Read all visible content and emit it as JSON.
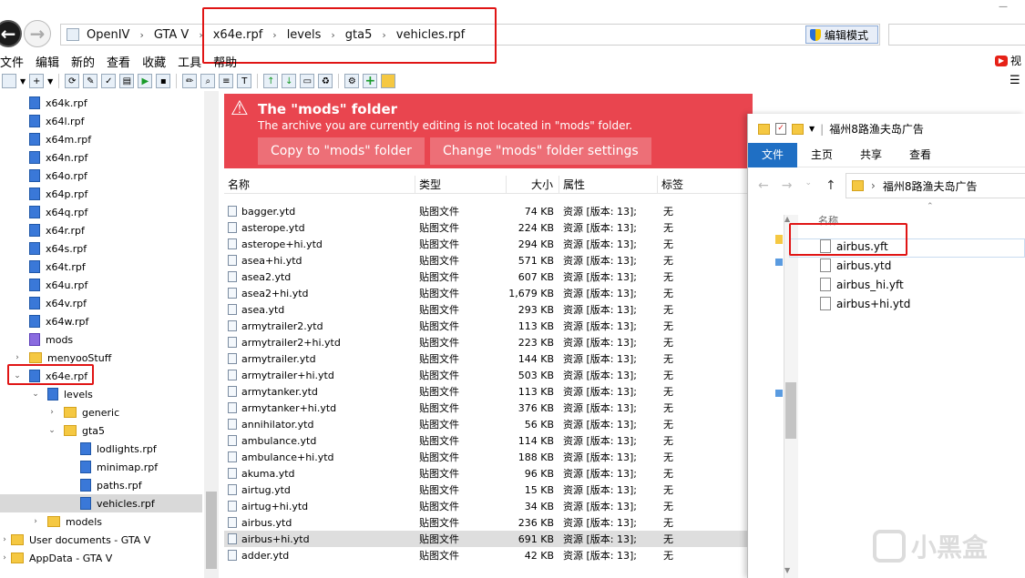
{
  "breadcrumb": {
    "items": [
      "OpenIV",
      "GTA V",
      "x64e.rpf",
      "levels",
      "gta5",
      "vehicles.rpf"
    ],
    "separator": "›"
  },
  "toolbar_top": {
    "edit_mode_label": "编辑模式"
  },
  "menu": [
    "文件",
    "编辑",
    "新的",
    "查看",
    "收藏",
    "工具",
    "帮助"
  ],
  "right_menu_partial": "视",
  "tree": {
    "items": [
      {
        "label": "x64k.rpf",
        "type": "rpf",
        "level": 1
      },
      {
        "label": "x64l.rpf",
        "type": "rpf",
        "level": 1
      },
      {
        "label": "x64m.rpf",
        "type": "rpf",
        "level": 1
      },
      {
        "label": "x64n.rpf",
        "type": "rpf",
        "level": 1
      },
      {
        "label": "x64o.rpf",
        "type": "rpf",
        "level": 1
      },
      {
        "label": "x64p.rpf",
        "type": "rpf",
        "level": 1
      },
      {
        "label": "x64q.rpf",
        "type": "rpf",
        "level": 1
      },
      {
        "label": "x64r.rpf",
        "type": "rpf",
        "level": 1
      },
      {
        "label": "x64s.rpf",
        "type": "rpf",
        "level": 1
      },
      {
        "label": "x64t.rpf",
        "type": "rpf",
        "level": 1
      },
      {
        "label": "x64u.rpf",
        "type": "rpf",
        "level": 1
      },
      {
        "label": "x64v.rpf",
        "type": "rpf",
        "level": 1
      },
      {
        "label": "x64w.rpf",
        "type": "rpf",
        "level": 1
      },
      {
        "label": "mods",
        "type": "mods",
        "level": 1
      },
      {
        "label": "menyooStuff",
        "type": "folder",
        "level": 1,
        "arrow": "›"
      },
      {
        "label": "x64e.rpf",
        "type": "rpf",
        "level": 1,
        "arrow": "⌄"
      },
      {
        "label": "levels",
        "type": "rpf",
        "level": 2,
        "arrow": "⌄"
      },
      {
        "label": "generic",
        "type": "folder",
        "level": 3,
        "arrow": "›"
      },
      {
        "label": "gta5",
        "type": "folder",
        "level": 3,
        "arrow": "⌄"
      },
      {
        "label": "lodlights.rpf",
        "type": "rpf",
        "level": 4
      },
      {
        "label": "minimap.rpf",
        "type": "rpf",
        "level": 4
      },
      {
        "label": "paths.rpf",
        "type": "rpf",
        "level": 4
      },
      {
        "label": "vehicles.rpf",
        "type": "rpf",
        "level": 4,
        "selected": true
      },
      {
        "label": "models",
        "type": "folder",
        "level": 2,
        "arrow": "›"
      },
      {
        "label": "User documents - GTA V",
        "type": "folder",
        "level": 0,
        "arrow": "›"
      },
      {
        "label": "AppData - GTA V",
        "type": "folder",
        "level": 0,
        "arrow": "›"
      }
    ]
  },
  "banner": {
    "icon": "warning-icon",
    "title": "The \"mods\" folder",
    "description": "The archive you are currently editing is not located in \"mods\" folder.",
    "copy_button": "Copy to \"mods\" folder",
    "change_button": "Change \"mods\" folder settings",
    "color": "#e9454f"
  },
  "columns": {
    "name": "名称",
    "type": "类型",
    "size": "大小",
    "attr": "属性",
    "tag": "标签"
  },
  "files": [
    {
      "name": "bagger.ytd",
      "type": "贴图文件",
      "size": "74 KB",
      "attr": "资源 [版本: 13];",
      "tag": "无"
    },
    {
      "name": "asterope.ytd",
      "type": "贴图文件",
      "size": "224 KB",
      "attr": "资源 [版本: 13];",
      "tag": "无"
    },
    {
      "name": "asterope+hi.ytd",
      "type": "贴图文件",
      "size": "294 KB",
      "attr": "资源 [版本: 13];",
      "tag": "无"
    },
    {
      "name": "asea+hi.ytd",
      "type": "贴图文件",
      "size": "571 KB",
      "attr": "资源 [版本: 13];",
      "tag": "无"
    },
    {
      "name": "asea2.ytd",
      "type": "贴图文件",
      "size": "607 KB",
      "attr": "资源 [版本: 13];",
      "tag": "无"
    },
    {
      "name": "asea2+hi.ytd",
      "type": "贴图文件",
      "size": "1,679 KB",
      "attr": "资源 [版本: 13];",
      "tag": "无"
    },
    {
      "name": "asea.ytd",
      "type": "贴图文件",
      "size": "293 KB",
      "attr": "资源 [版本: 13];",
      "tag": "无"
    },
    {
      "name": "armytrailer2.ytd",
      "type": "贴图文件",
      "size": "113 KB",
      "attr": "资源 [版本: 13];",
      "tag": "无"
    },
    {
      "name": "armytrailer2+hi.ytd",
      "type": "贴图文件",
      "size": "223 KB",
      "attr": "资源 [版本: 13];",
      "tag": "无"
    },
    {
      "name": "armytrailer.ytd",
      "type": "贴图文件",
      "size": "144 KB",
      "attr": "资源 [版本: 13];",
      "tag": "无"
    },
    {
      "name": "armytrailer+hi.ytd",
      "type": "贴图文件",
      "size": "503 KB",
      "attr": "资源 [版本: 13];",
      "tag": "无"
    },
    {
      "name": "armytanker.ytd",
      "type": "贴图文件",
      "size": "113 KB",
      "attr": "资源 [版本: 13];",
      "tag": "无"
    },
    {
      "name": "armytanker+hi.ytd",
      "type": "贴图文件",
      "size": "376 KB",
      "attr": "资源 [版本: 13];",
      "tag": "无"
    },
    {
      "name": "annihilator.ytd",
      "type": "贴图文件",
      "size": "56 KB",
      "attr": "资源 [版本: 13];",
      "tag": "无"
    },
    {
      "name": "ambulance.ytd",
      "type": "贴图文件",
      "size": "114 KB",
      "attr": "资源 [版本: 13];",
      "tag": "无"
    },
    {
      "name": "ambulance+hi.ytd",
      "type": "贴图文件",
      "size": "188 KB",
      "attr": "资源 [版本: 13];",
      "tag": "无"
    },
    {
      "name": "akuma.ytd",
      "type": "贴图文件",
      "size": "96 KB",
      "attr": "资源 [版本: 13];",
      "tag": "无"
    },
    {
      "name": "airtug.ytd",
      "type": "贴图文件",
      "size": "15 KB",
      "attr": "资源 [版本: 13];",
      "tag": "无"
    },
    {
      "name": "airtug+hi.ytd",
      "type": "贴图文件",
      "size": "34 KB",
      "attr": "资源 [版本: 13];",
      "tag": "无"
    },
    {
      "name": "airbus.ytd",
      "type": "贴图文件",
      "size": "236 KB",
      "attr": "资源 [版本: 13];",
      "tag": "无"
    },
    {
      "name": "airbus+hi.ytd",
      "type": "贴图文件",
      "size": "691 KB",
      "attr": "资源 [版本: 13];",
      "tag": "无",
      "selected": true
    },
    {
      "name": "adder.ytd",
      "type": "贴图文件",
      "size": "42 KB",
      "attr": "资源 [版本: 13];",
      "tag": "无"
    }
  ],
  "explorer": {
    "title": "福州8路渔夫岛广告",
    "tabs": [
      "文件",
      "主页",
      "共享",
      "查看"
    ],
    "path": "福州8路渔夫岛广告",
    "column_name": "名称",
    "items": [
      "airbus.yft",
      "airbus.ytd",
      "airbus_hi.yft",
      "airbus+hi.ytd"
    ]
  },
  "watermark": {
    "text": "小黑盒"
  }
}
